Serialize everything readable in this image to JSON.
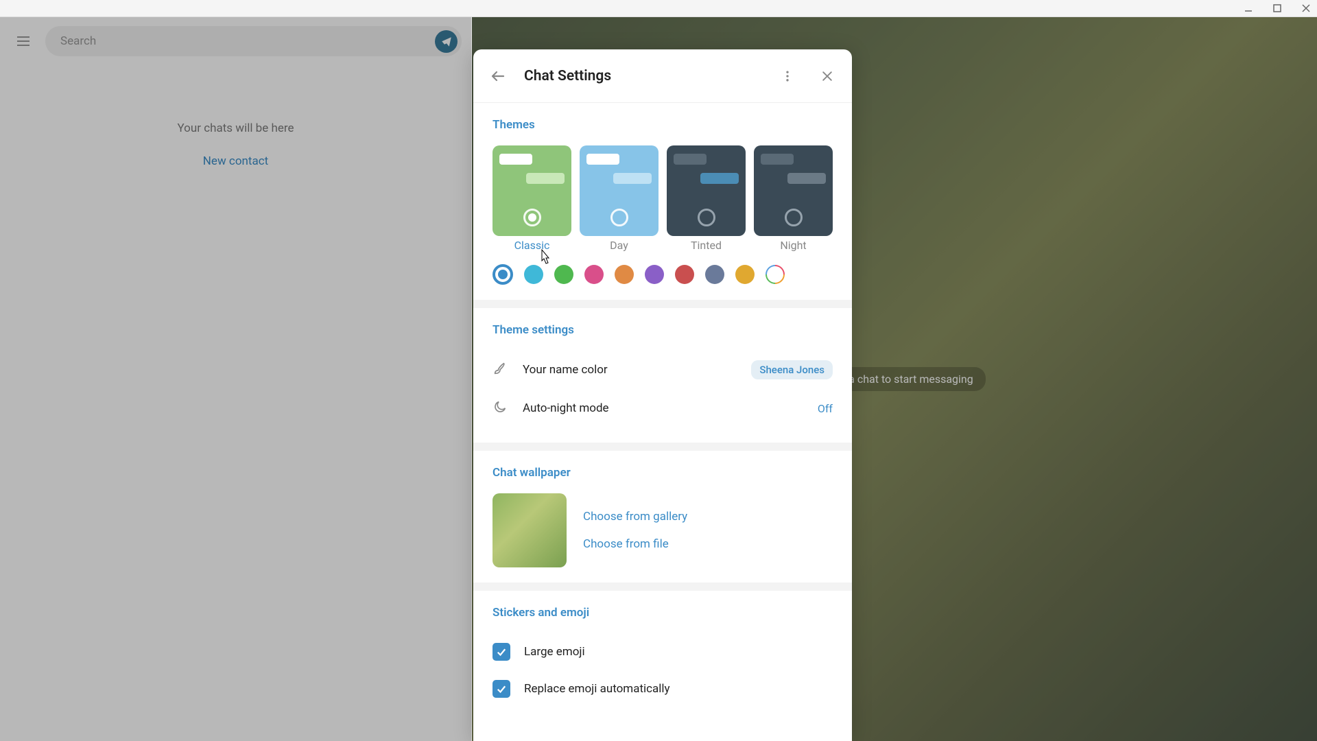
{
  "window": {
    "titlebar": {
      "minimize": "minimize",
      "maximize": "maximize",
      "close": "close"
    }
  },
  "sidebar": {
    "search_placeholder": "Search",
    "empty_text": "Your chats will be here",
    "new_contact": "New contact"
  },
  "chat_area": {
    "hint": "Select a chat to start messaging"
  },
  "modal": {
    "title": "Chat Settings",
    "themes": {
      "title": "Themes",
      "items": [
        {
          "id": "classic",
          "label": "Classic",
          "selected": true
        },
        {
          "id": "day",
          "label": "Day",
          "selected": false
        },
        {
          "id": "tinted",
          "label": "Tinted",
          "selected": false
        },
        {
          "id": "night",
          "label": "Night",
          "selected": false
        }
      ],
      "accent_colors": [
        {
          "hex": "#3b8cc7",
          "selected": true
        },
        {
          "hex": "#3fb8d8"
        },
        {
          "hex": "#4fb84f"
        },
        {
          "hex": "#d94f8a"
        },
        {
          "hex": "#e08a44"
        },
        {
          "hex": "#8a5fc7"
        },
        {
          "hex": "#c94f4f"
        },
        {
          "hex": "#6a7a9a"
        },
        {
          "hex": "#e0a830"
        },
        {
          "hex": "multi"
        }
      ]
    },
    "theme_settings": {
      "title": "Theme settings",
      "name_color": {
        "label": "Your name color",
        "value": "Sheena Jones"
      },
      "auto_night": {
        "label": "Auto-night mode",
        "value": "Off"
      }
    },
    "wallpaper": {
      "title": "Chat wallpaper",
      "choose_gallery": "Choose from gallery",
      "choose_file": "Choose from file"
    },
    "stickers": {
      "title": "Stickers and emoji",
      "large_emoji": {
        "label": "Large emoji",
        "checked": true
      },
      "replace_emoji": {
        "label": "Replace emoji automatically",
        "checked": true
      }
    }
  }
}
